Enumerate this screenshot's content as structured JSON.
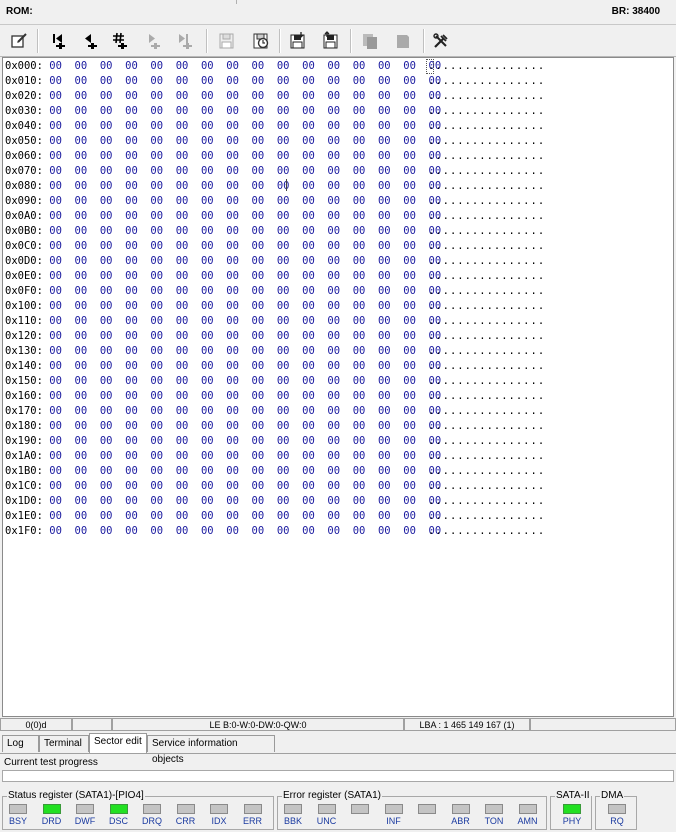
{
  "topbar": {
    "rom_label": "ROM:",
    "br_label": "BR: 38400"
  },
  "toolbar": {
    "tools": [
      {
        "name": "sector-edit-icon",
        "enabled": true
      },
      {
        "name": "first-sector-icon",
        "enabled": true
      },
      {
        "name": "prev-sector-icon",
        "enabled": true
      },
      {
        "name": "goto-sector-icon",
        "enabled": true
      },
      {
        "name": "next-sector-icon",
        "enabled": false
      },
      {
        "name": "last-sector-icon",
        "enabled": false
      },
      {
        "name": "save-sector-icon",
        "enabled": false
      },
      {
        "name": "read-sector-icon",
        "enabled": true
      },
      {
        "name": "save-to-file-icon",
        "enabled": true
      },
      {
        "name": "load-from-file-icon",
        "enabled": true
      },
      {
        "name": "copy-icon",
        "enabled": false
      },
      {
        "name": "paste-icon",
        "enabled": false
      },
      {
        "name": "tools-icon",
        "enabled": true
      }
    ]
  },
  "hex": {
    "byte_value": "00",
    "bytes_per_row": 16,
    "ascii_row": "................",
    "addresses": [
      "0x000:",
      "0x010:",
      "0x020:",
      "0x030:",
      "0x040:",
      "0x050:",
      "0x060:",
      "0x070:",
      "0x080:",
      "0x090:",
      "0x0A0:",
      "0x0B0:",
      "0x0C0:",
      "0x0D0:",
      "0x0E0:",
      "0x0F0:",
      "0x100:",
      "0x110:",
      "0x120:",
      "0x130:",
      "0x140:",
      "0x150:",
      "0x160:",
      "0x170:",
      "0x180:",
      "0x190:",
      "0x1A0:",
      "0x1B0:",
      "0x1C0:",
      "0x1D0:",
      "0x1E0:",
      "0x1F0:"
    ]
  },
  "statusline": {
    "offset": "0(0)d",
    "format": "LE B:0-W:0-DW:0-QW:0",
    "lba": "LBA : 1 465 149 167 (1)"
  },
  "tabs": [
    {
      "label": "Log",
      "active": false
    },
    {
      "label": "Terminal",
      "active": false
    },
    {
      "label": "Sector edit",
      "active": true
    },
    {
      "label": "Service information objects",
      "active": false
    }
  ],
  "progress": {
    "label": "Current test progress",
    "value": 0
  },
  "registers": {
    "status": {
      "title": "Status register (SATA1)-[PIO4]",
      "bits": [
        {
          "label": "BSY",
          "on": false
        },
        {
          "label": "DRD",
          "on": true
        },
        {
          "label": "DWF",
          "on": false
        },
        {
          "label": "DSC",
          "on": true
        },
        {
          "label": "DRQ",
          "on": false
        },
        {
          "label": "CRR",
          "on": false
        },
        {
          "label": "IDX",
          "on": false
        },
        {
          "label": "ERR",
          "on": false
        }
      ]
    },
    "error": {
      "title": "Error register (SATA1)",
      "bits": [
        {
          "label": "BBK",
          "on": false
        },
        {
          "label": "UNC",
          "on": false
        },
        {
          "label": "",
          "on": false
        },
        {
          "label": "INF",
          "on": false
        },
        {
          "label": "",
          "on": false
        },
        {
          "label": "ABR",
          "on": false
        },
        {
          "label": "TON",
          "on": false
        },
        {
          "label": "AMN",
          "on": false
        }
      ]
    },
    "sata": {
      "title": "SATA-II",
      "bits": [
        {
          "label": "PHY",
          "on": true
        }
      ]
    },
    "dma": {
      "title": "DMA",
      "bits": [
        {
          "label": "RQ",
          "on": false
        }
      ]
    }
  }
}
